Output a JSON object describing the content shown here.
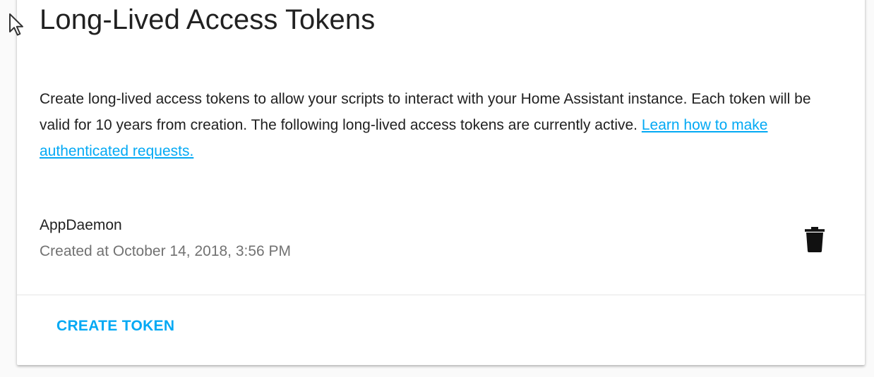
{
  "card": {
    "title": "Long-Lived Access Tokens",
    "description_text": "Create long-lived access tokens to allow your scripts to interact with your Home Assistant instance. Each token will be valid for 10 years from creation. The following long-lived access tokens are currently active.",
    "learn_link": "Learn how to make authenticated requests."
  },
  "tokens": [
    {
      "name": "AppDaemon",
      "created": "Created at October 14, 2018, 3:56 PM",
      "delete_icon": "trash-icon"
    }
  ],
  "actions": {
    "create_label": "CREATE TOKEN"
  },
  "colors": {
    "accent": "#03a9f4",
    "primary_text": "#212121",
    "secondary_text": "#727272"
  }
}
